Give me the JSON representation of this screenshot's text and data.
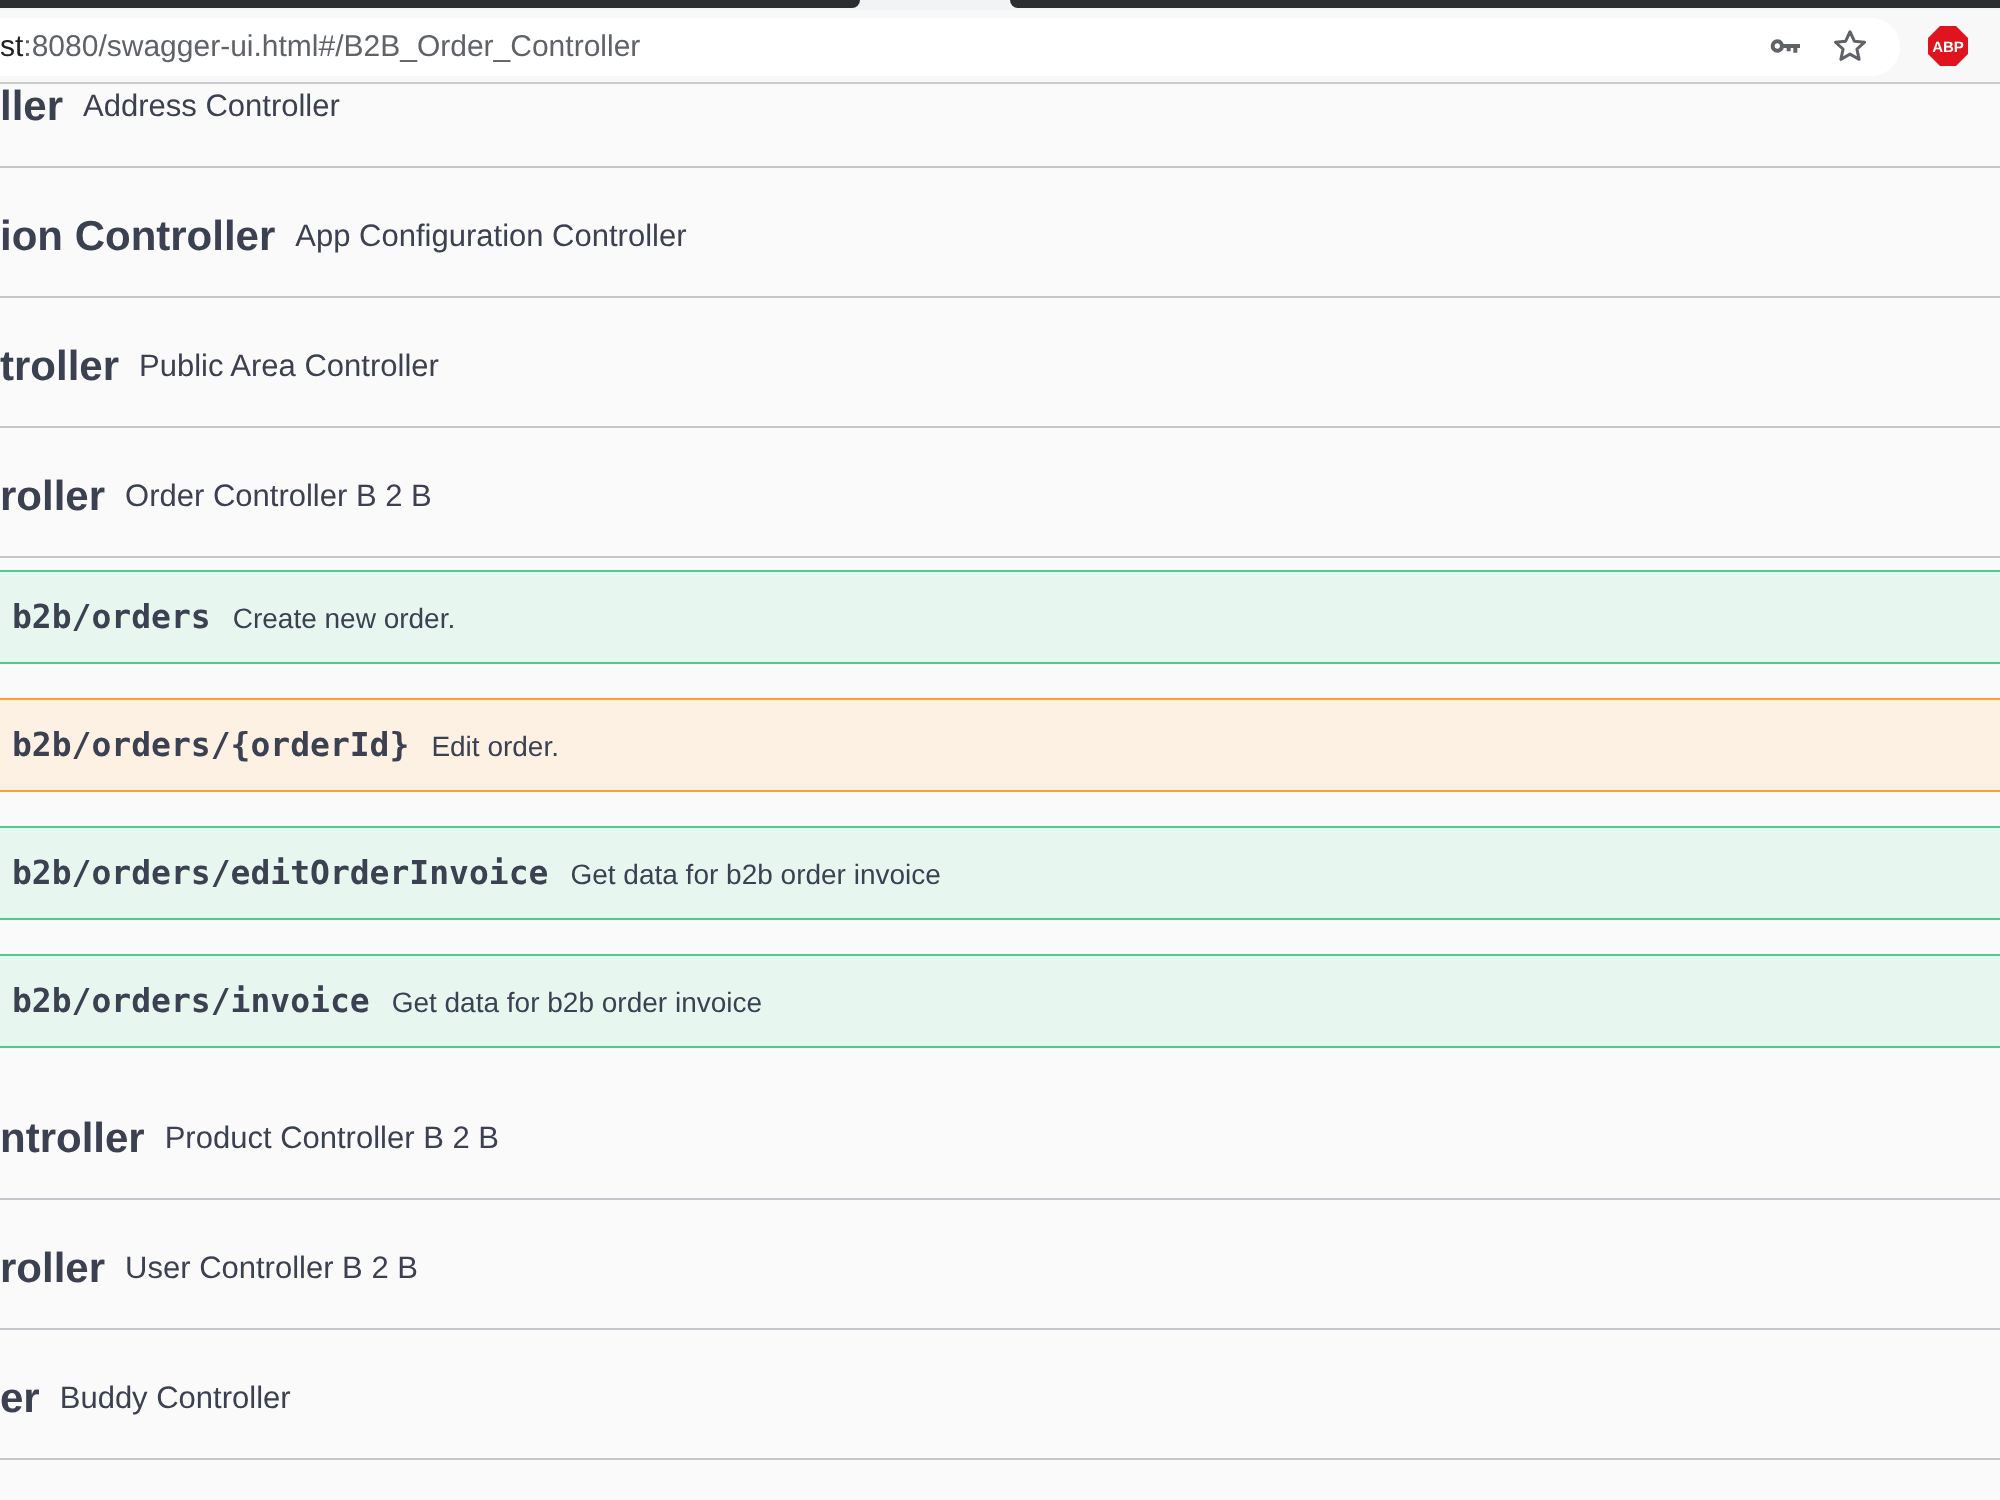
{
  "address_bar": {
    "host": "st",
    "path": ":8080/swagger-ui.html#/B2B_Order_Controller"
  },
  "extension": {
    "label": "ABP"
  },
  "tags": [
    {
      "name": "ller",
      "description": "Address Controller"
    },
    {
      "name": "ion Controller",
      "description": "App Configuration Controller"
    },
    {
      "name": "troller",
      "description": "Public Area Controller"
    },
    {
      "name": "roller",
      "description": "Order Controller B 2 B",
      "operations": [
        {
          "kind": "post",
          "path": "b2b/orders",
          "summary": "Create new order."
        },
        {
          "kind": "put",
          "path": "b2b/orders/{orderId}",
          "summary": "Edit order."
        },
        {
          "kind": "post",
          "path": "b2b/orders/editOrderInvoice",
          "summary": "Get data for b2b order invoice"
        },
        {
          "kind": "post",
          "path": "b2b/orders/invoice",
          "summary": "Get data for b2b order invoice"
        }
      ]
    },
    {
      "name": "ntroller",
      "description": "Product Controller B 2 B"
    },
    {
      "name": "roller",
      "description": "User Controller B 2 B"
    },
    {
      "name": "er",
      "description": "Buddy Controller"
    }
  ]
}
